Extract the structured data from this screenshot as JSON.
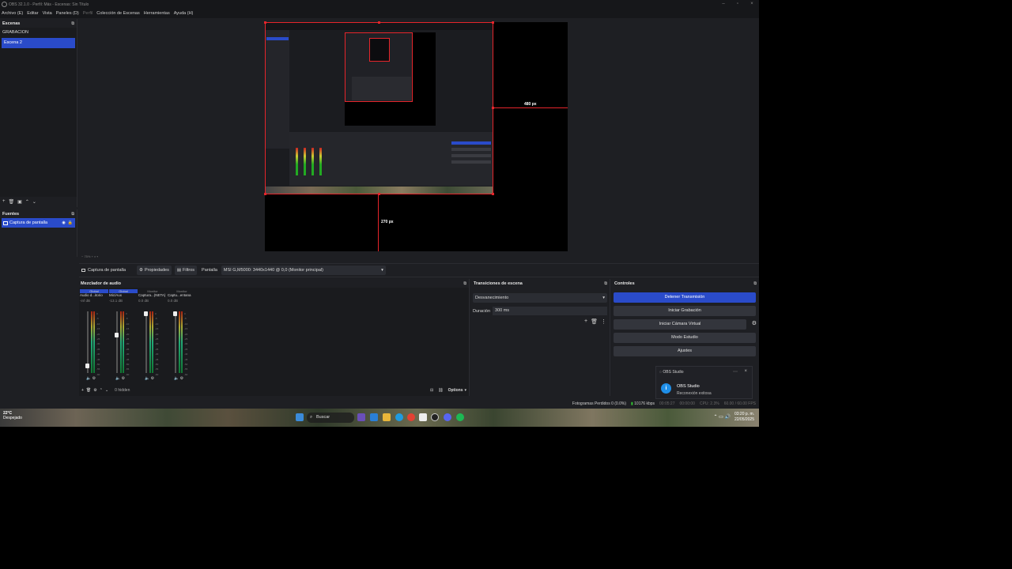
{
  "window": {
    "title": "OBS 32.1.0 - Perfil: Más - Escenas: Sin Título",
    "minimize": "–",
    "maximize": "▫",
    "close": "×"
  },
  "menu": [
    "Archivo (E)",
    "Editar",
    "Vista",
    "Paneles (D)",
    "Perfil",
    "Colección de Escenas",
    "Herramientas",
    "Ayuda (H)"
  ],
  "scenes": {
    "title": "Escenas",
    "items": [
      "GRABACION",
      "Escena 2"
    ],
    "selected": 1
  },
  "sources": {
    "title": "Fuentes",
    "items": [
      "Captura de pantalla"
    ]
  },
  "preview": {
    "guide_right": "480 px",
    "guide_bottom": "270 px"
  },
  "source_toolbar": {
    "source_name": "Captura de pantalla",
    "properties": "Propiedades",
    "filters": "Filtros",
    "display_label": "Pantalla",
    "display_value": "MSI G,M5000: 3440x1440 @ 0,0 (Monitor principal)"
  },
  "mixer": {
    "title": "Mezclador de audio",
    "channels": [
      {
        "head": "Global",
        "name": "Audio d...itorio",
        "db": "-inf dB",
        "level": 0.08
      },
      {
        "head": "Global",
        "name": "Mic/Aux",
        "db": "-13.1 dB",
        "level": 0.62
      },
      {
        "head": "Monitor",
        "name": "Captura...(NETA)",
        "db": "0.0 dB",
        "level": 1.0
      },
      {
        "head": "Monitor",
        "name": "Captu...entana",
        "db": "0.0 dB",
        "level": 1.0
      }
    ],
    "scale": [
      "0",
      "-5",
      "-10",
      "-15",
      "-20",
      "-25",
      "-30",
      "-35",
      "-40",
      "-45",
      "-50",
      "-55",
      "-60"
    ],
    "hidden": "0 hidden",
    "options": "Options"
  },
  "transitions": {
    "title": "Transiciones de escena",
    "type": "Desvanecimiento",
    "duration_label": "Duración",
    "duration_value": "300 ms"
  },
  "controls": {
    "title": "Controles",
    "buttons": [
      "Detener Transmisión",
      "Iniciar Grabación",
      "Iniciar Cámara Virtual",
      "Modo Estudio",
      "Ajustes"
    ]
  },
  "notification": {
    "app": "OBS Studio",
    "title": "OBS Studio",
    "body": "Reconexión exitosa"
  },
  "status": {
    "dropped": "Fotogramas Perdidos 0 (0.0%)",
    "bitrate": "10176 kbps",
    "live": "00:05:27",
    "rec": "00:00:00",
    "cpu": "CPU: 2.3%",
    "fps": "60.00 / 60.00 FPS"
  },
  "taskbar": {
    "temp": "22°C",
    "weather": "Despejado",
    "search": "Buscar",
    "time": "03:20 p. m.",
    "date": "22/05/2025"
  },
  "colors": {
    "accent": "#2a4bc9",
    "guide": "#e5252b",
    "bg": "#1e1f23"
  }
}
